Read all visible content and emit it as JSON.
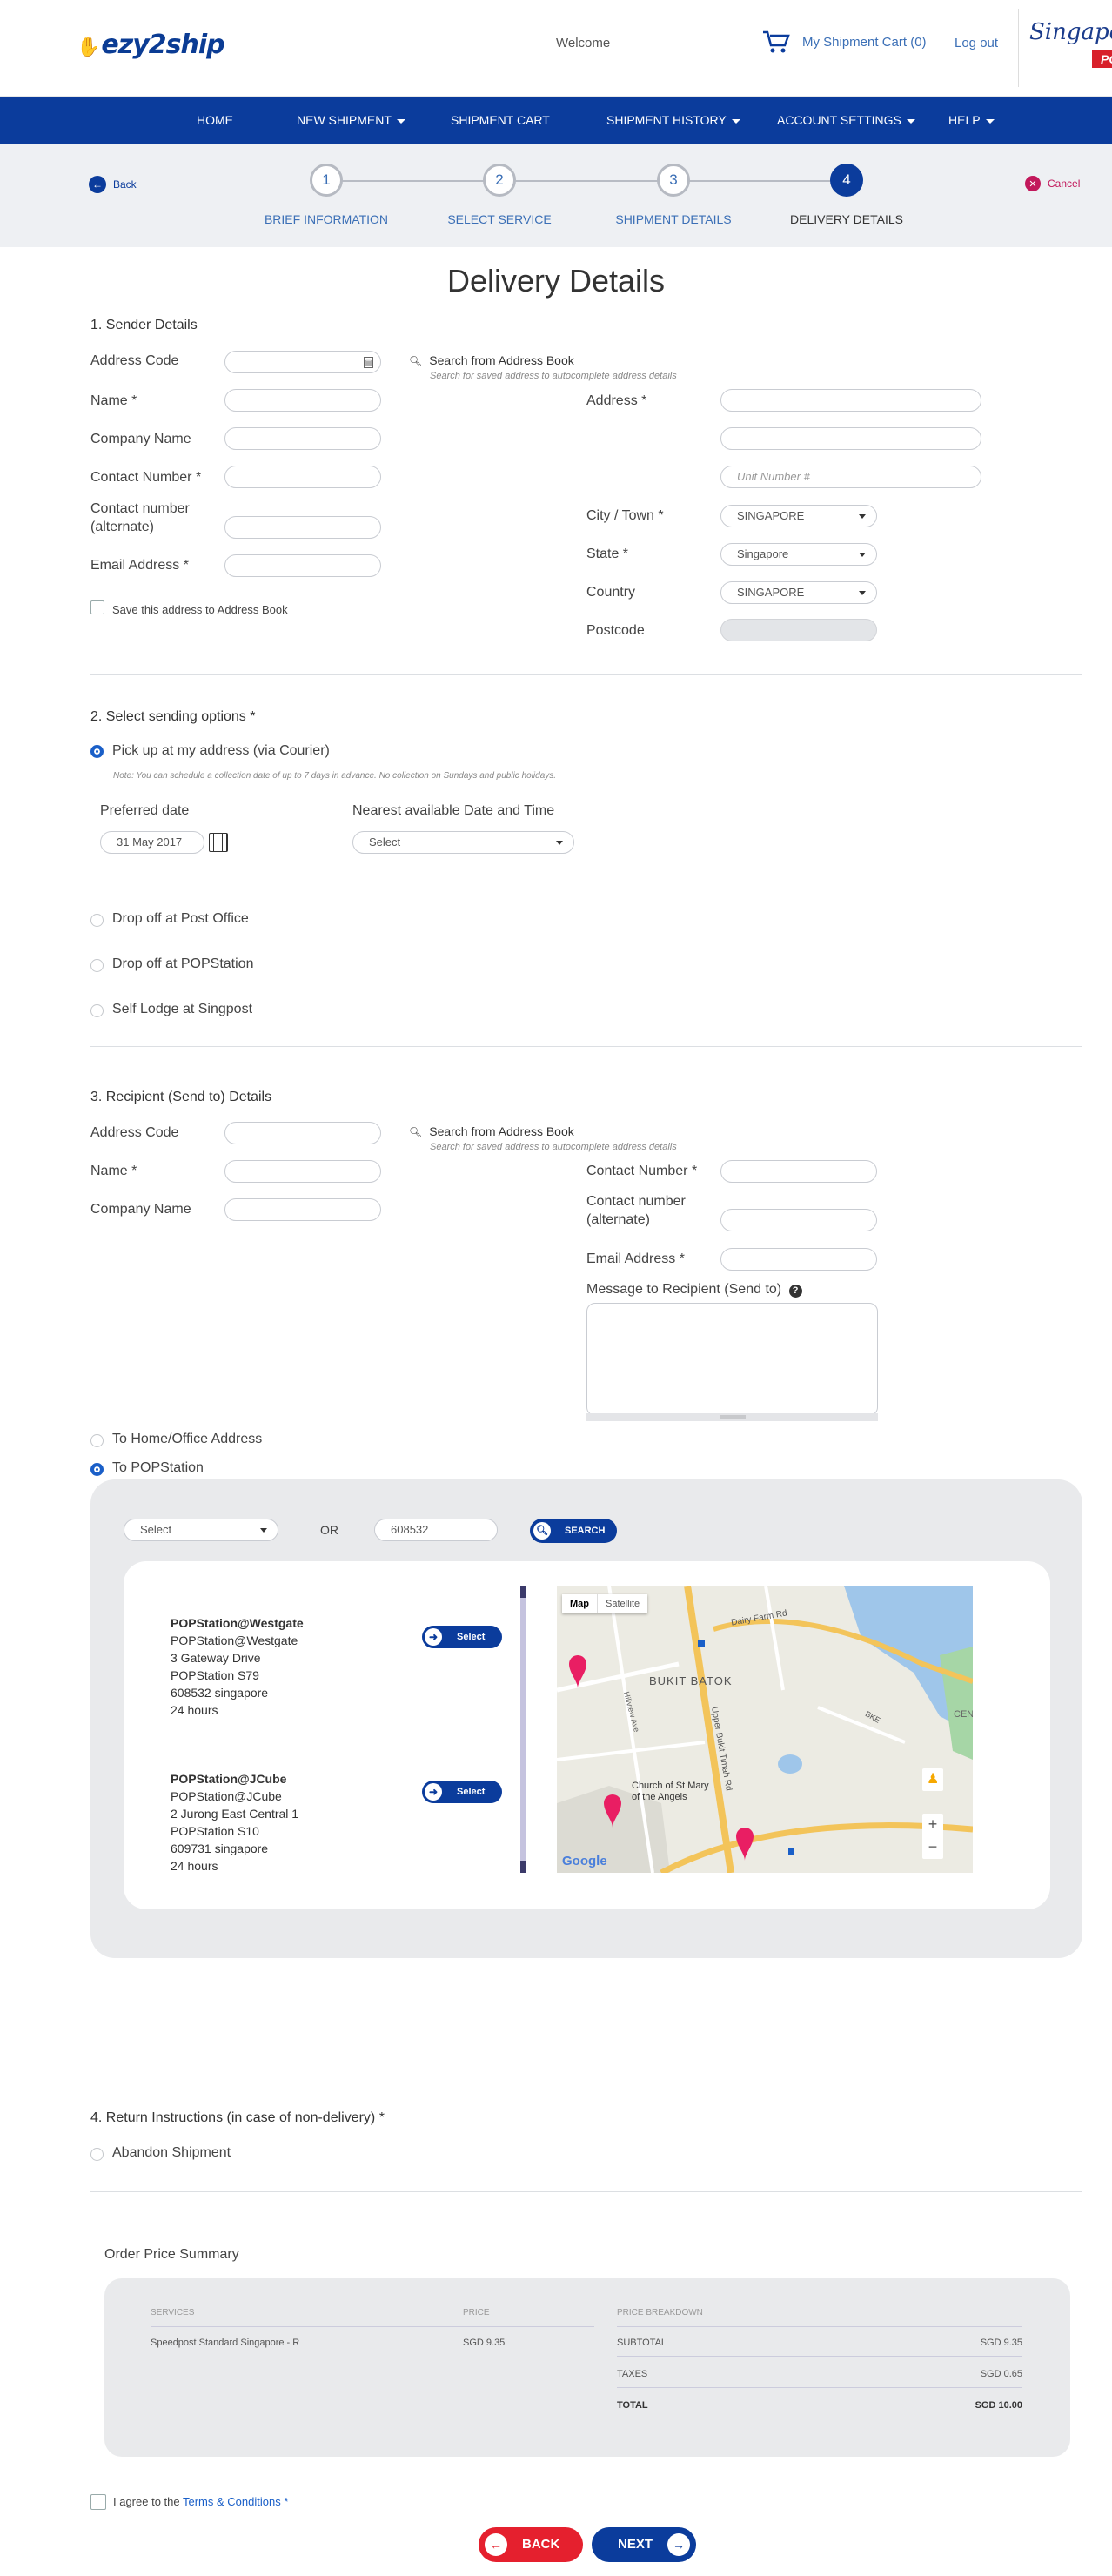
{
  "header": {
    "logo": "ezy2ship",
    "welcome": "Welcome",
    "cart": "My Shipment Cart (0)",
    "logout": "Log out",
    "sp_logo": "Singapore",
    "sp_post": "POST"
  },
  "nav": {
    "items": [
      {
        "label": "HOME",
        "dropdown": false
      },
      {
        "label": "NEW SHIPMENT",
        "dropdown": true
      },
      {
        "label": "SHIPMENT CART",
        "dropdown": false
      },
      {
        "label": "SHIPMENT HISTORY",
        "dropdown": true
      },
      {
        "label": "ACCOUNT SETTINGS",
        "dropdown": true
      },
      {
        "label": "HELP",
        "dropdown": true
      }
    ]
  },
  "steps": {
    "back": "Back",
    "cancel": "Cancel",
    "items": [
      {
        "num": "1",
        "label": "BRIEF INFORMATION"
      },
      {
        "num": "2",
        "label": "SELECT SERVICE"
      },
      {
        "num": "3",
        "label": "SHIPMENT DETAILS"
      },
      {
        "num": "4",
        "label": "DELIVERY DETAILS",
        "active": true
      }
    ]
  },
  "title": "Delivery Details",
  "sender": {
    "heading": "1. Sender Details",
    "address_code": "Address Code",
    "name": "Name *",
    "company": "Company Name",
    "contact": "Contact Number *",
    "contact_alt": "Contact number (alternate)",
    "email": "Email Address *",
    "search_link": "Search from Address Book",
    "search_hint": "Search for saved address to autocomplete address details",
    "address": "Address *",
    "unit_placeholder": "Unit Number #",
    "city": "City / Town *",
    "city_value": "SINGAPORE",
    "state": "State *",
    "state_value": "Singapore",
    "country": "Country",
    "country_value": "SINGAPORE",
    "postcode": "Postcode",
    "save": "Save this address to Address Book"
  },
  "sending": {
    "heading": "2. Select sending options *",
    "pickup": "Pick up at my address (via Courier)",
    "note": "Note: You can schedule a collection date of up to 7 days in advance. No collection on Sundays and public holidays.",
    "preferred_date": "Preferred date",
    "date_value": "31 May 2017",
    "nearest": "Nearest available Date and Time",
    "nearest_value": "Select",
    "dropoff_po": "Drop off at Post Office",
    "dropoff_pop": "Drop off at POPStation",
    "self_lodge": "Self Lodge at Singpost"
  },
  "recipient": {
    "heading": "3. Recipient (Send to) Details",
    "address_code": "Address Code",
    "name": "Name *",
    "company": "Company Name",
    "search_link": "Search from Address Book",
    "search_hint": "Search for saved address to autocomplete address details",
    "contact": "Contact Number *",
    "contact_alt": "Contact number (alternate)",
    "email": "Email Address *",
    "message": "Message to Recipient (Send to)",
    "to_home": "To Home/Office Address",
    "to_pop": "To POPStation"
  },
  "popstation": {
    "select": "Select",
    "or": "OR",
    "postcode": "608532",
    "search": "SEARCH",
    "select_btn": "Select",
    "list": [
      {
        "name": "POPStation@Westgate",
        "lines": [
          "POPStation@Westgate",
          "3 Gateway Drive",
          "POPStation S79",
          "608532 singapore",
          "24 hours"
        ]
      },
      {
        "name": "POPStation@JCube",
        "lines": [
          "POPStation@JCube",
          "2 Jurong East Central 1",
          "POPStation S10",
          "609731 singapore",
          "24 hours"
        ]
      }
    ],
    "map": {
      "tab_map": "Map",
      "tab_sat": "Satellite",
      "labels": [
        "BUKIT BATOK",
        "Dairy Farm Rd",
        "Church of St Mary of the Angels",
        "Upper Bukit Timah Rd",
        "Hillview Ave",
        "BKE",
        "CEN",
        "Google"
      ]
    }
  },
  "return": {
    "heading": "4. Return Instructions (in case of non-delivery) *",
    "abandon": "Abandon Shipment"
  },
  "summary": {
    "heading": "Order Price Summary",
    "col_services": "SERVICES",
    "col_price": "PRICE",
    "col_breakdown": "PRICE BREAKDOWN",
    "service": "Speedpost Standard Singapore - R",
    "price": "SGD 9.35",
    "subtotal_label": "SUBTOTAL",
    "subtotal": "SGD 9.35",
    "taxes_label": "TAXES",
    "taxes": "SGD 0.65",
    "total_label": "TOTAL",
    "total": "SGD 10.00"
  },
  "agree": {
    "prefix": "I agree to the ",
    "link": "Terms & Conditions",
    "suffix": " *"
  },
  "buttons": {
    "back": "BACK",
    "next": "NEXT"
  }
}
